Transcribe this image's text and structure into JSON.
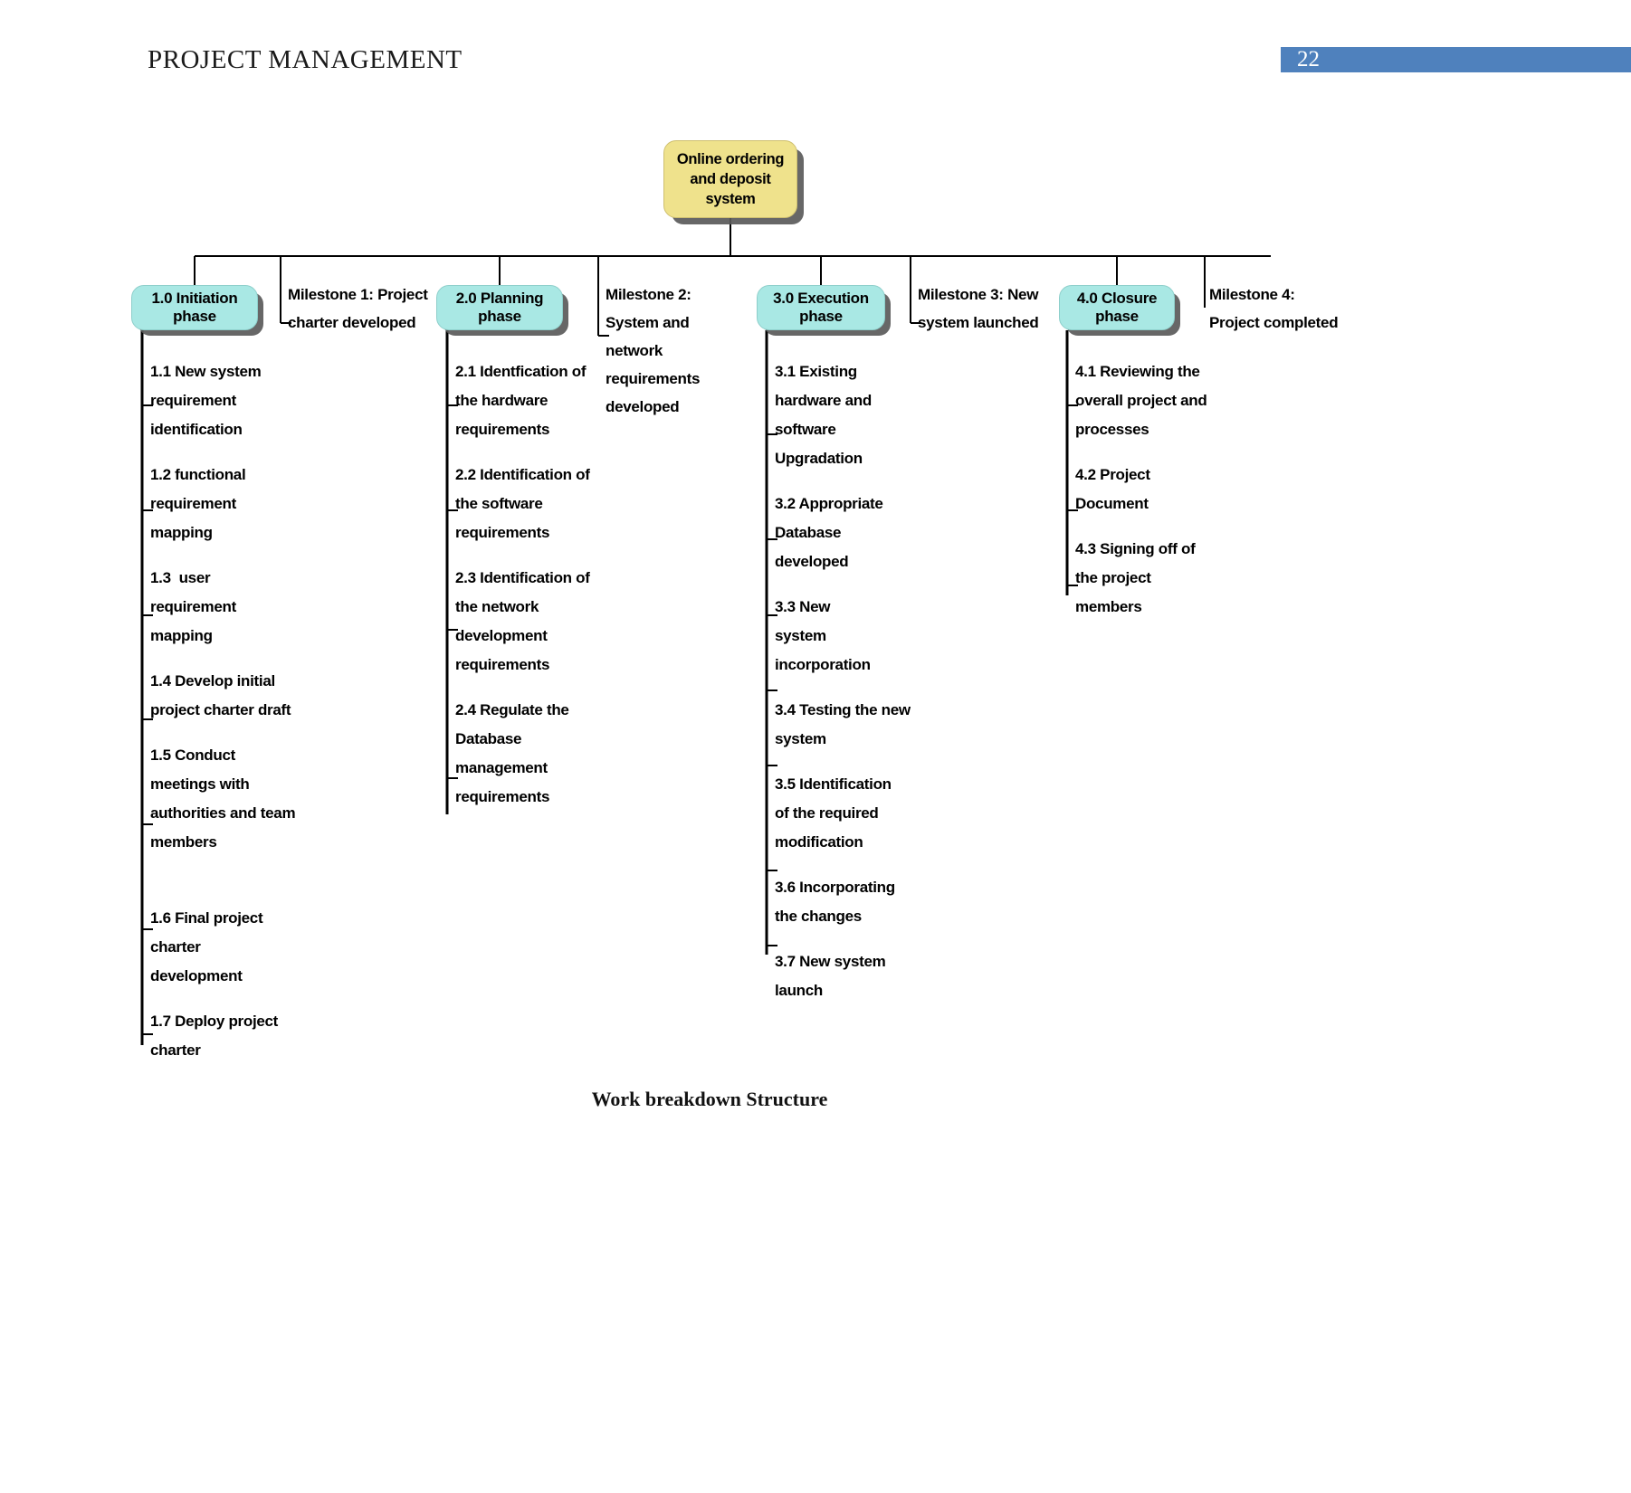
{
  "header": {
    "doc_title": "PROJECT MANAGEMENT",
    "page_number": "22",
    "banner_color": "#4f81bd"
  },
  "diagram": {
    "caption": "Work breakdown Structure",
    "root": {
      "label": "Online ordering and deposit system",
      "fill_color": "#efe28c"
    },
    "phase_fill_color": "#a9e8e4",
    "phases": [
      {
        "label": "1.0 Initiation phase",
        "subtasks": [
          "1.1 New system requirement identification",
          "1.2 functional requirement mapping",
          "1.3  user requirement mapping",
          "1.4 Develop initial project charter draft",
          "1.5 Conduct meetings with authorities and team members",
          "1.6 Final project charter development",
          "1.7 Deploy project charter"
        ]
      },
      {
        "label": "2.0 Planning phase",
        "subtasks": [
          "2.1 Identfication of the hardware requirements",
          "2.2 Identification of the software requirements",
          "2.3 Identification of the network development requirements",
          "2.4 Regulate the Database management requirements"
        ]
      },
      {
        "label": "3.0 Execution phase",
        "subtasks": [
          "3.1 Existing hardware and software Upgradation",
          "3.2 Appropriate Database developed",
          "3.3 New system incorporation",
          "3.4 Testing the new system",
          "3.5 Identification of the required modification",
          "3.6 Incorporating the changes",
          "3.7 New system launch"
        ]
      },
      {
        "label": "4.0 Closure phase",
        "subtasks": [
          "4.1 Reviewing the overall project and processes",
          "4.2 Project Document",
          "4.3 Signing off of the project members"
        ]
      }
    ],
    "milestones": [
      "Milestone 1: Project charter developed",
      "Milestone 2: System and network requirements developed",
      "Milestone 3:  New system launched",
      "Milestone 4: Project completed"
    ]
  }
}
